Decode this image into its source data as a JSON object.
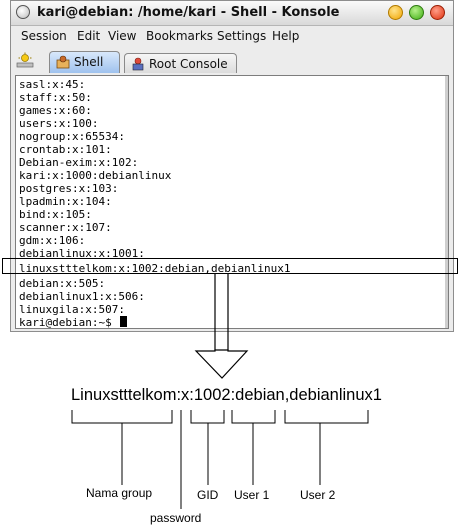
{
  "window": {
    "title": "kari@debian: /home/kari - Shell - Konsole"
  },
  "menu": [
    "Session",
    "Edit",
    "View",
    "Bookmarks",
    "Settings",
    "Help"
  ],
  "tabs": [
    {
      "label": "Shell",
      "active": true
    },
    {
      "label": "Root Console",
      "active": false
    }
  ],
  "terminal": {
    "lines": [
      "sasl:x:45:",
      "staff:x:50:",
      "games:x:60:",
      "users:x:100:",
      "nogroup:x:65534:",
      "crontab:x:101:",
      "Debian-exim:x:102:",
      "kari:x:1000:debianlinux",
      "postgres:x:103:",
      "lpadmin:x:104:",
      "bind:x:105:",
      "scanner:x:107:",
      "gdm:x:106:",
      "debianlinux:x:1001:",
      "linuxstttelkom:x:1002:debian,debianlinux1",
      "debian:x:505:",
      "debianlinux1:x:506:",
      "linuxgila:x:507:"
    ],
    "prompt": "kari@debian:~$"
  },
  "annotation": {
    "line": "Linuxstttelkom:x:1002:debian,debianlinux1",
    "labels": {
      "group_name": "Nama group",
      "password": "password",
      "gid": "GID",
      "user1": "User 1",
      "user2": "User 2"
    }
  },
  "colors": {
    "tab_active": "#9fc2ee",
    "close": "#e0320f",
    "maximize": "#3fae13",
    "minimize": "#f0a400"
  }
}
